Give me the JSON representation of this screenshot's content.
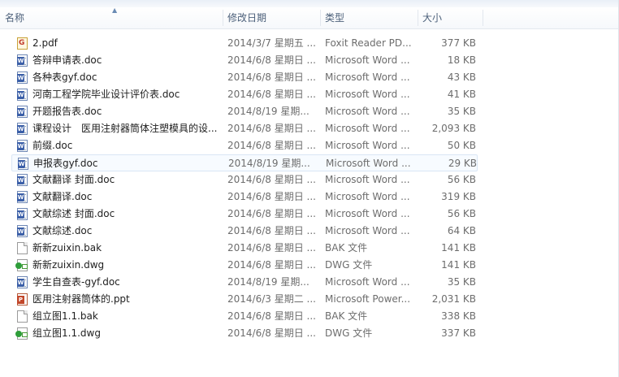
{
  "columns": {
    "name": "名称",
    "date": "修改日期",
    "type": "类型",
    "size": "大小"
  },
  "files": [
    {
      "name": "2.pdf",
      "date": "2014/3/7 星期五 ...",
      "type": "Foxit Reader PD...",
      "size": "377 KB",
      "icon": "pdf-icon"
    },
    {
      "name": "答辩申请表.doc",
      "date": "2014/6/8 星期日 ...",
      "type": "Microsoft Word ...",
      "size": "18 KB",
      "icon": "word-doc-icon"
    },
    {
      "name": "各种表gyf.doc",
      "date": "2014/6/8 星期日 ...",
      "type": "Microsoft Word ...",
      "size": "43 KB",
      "icon": "word-doc-icon"
    },
    {
      "name": "河南工程学院毕业设计评价表.doc",
      "date": "2014/6/8 星期日 ...",
      "type": "Microsoft Word ...",
      "size": "41 KB",
      "icon": "word-doc-icon"
    },
    {
      "name": "开题报告表.doc",
      "date": "2014/8/19 星期...",
      "type": "Microsoft Word ...",
      "size": "35 KB",
      "icon": "word-doc-icon"
    },
    {
      "name": "课程设计　医用注射器筒体注塑模具的设...",
      "date": "2014/6/8 星期日 ...",
      "type": "Microsoft Word ...",
      "size": "2,093 KB",
      "icon": "word-doc-icon"
    },
    {
      "name": "前缀.doc",
      "date": "2014/6/8 星期日 ...",
      "type": "Microsoft Word ...",
      "size": "50 KB",
      "icon": "word-doc-icon"
    },
    {
      "name": "申报表gyf.doc",
      "date": "2014/8/19 星期...",
      "type": "Microsoft Word ...",
      "size": "29 KB",
      "icon": "word-doc-icon",
      "selected": true
    },
    {
      "name": "文献翻译 封面.doc",
      "date": "2014/6/8 星期日 ...",
      "type": "Microsoft Word ...",
      "size": "56 KB",
      "icon": "word-doc-icon"
    },
    {
      "name": "文献翻译.doc",
      "date": "2014/6/8 星期日 ...",
      "type": "Microsoft Word ...",
      "size": "319 KB",
      "icon": "word-doc-icon"
    },
    {
      "name": "文献综述 封面.doc",
      "date": "2014/6/8 星期日 ...",
      "type": "Microsoft Word ...",
      "size": "56 KB",
      "icon": "word-doc-icon"
    },
    {
      "name": "文献综述.doc",
      "date": "2014/6/8 星期日 ...",
      "type": "Microsoft Word ...",
      "size": "64 KB",
      "icon": "word-doc-icon"
    },
    {
      "name": "新新zuixin.bak",
      "date": "2014/6/8 星期日 ...",
      "type": "BAK 文件",
      "size": "141 KB",
      "icon": "blank-file-icon"
    },
    {
      "name": "新新zuixin.dwg",
      "date": "2014/6/8 星期日 ...",
      "type": "DWG 文件",
      "size": "141 KB",
      "icon": "dwg-file-icon"
    },
    {
      "name": "学生自查表-gyf.doc",
      "date": "2014/8/19 星期...",
      "type": "Microsoft Word ...",
      "size": "35 KB",
      "icon": "word-doc-icon"
    },
    {
      "name": "医用注射器筒体的.ppt",
      "date": "2014/6/3 星期二 ...",
      "type": "Microsoft Power...",
      "size": "2,031 KB",
      "icon": "powerpoint-icon"
    },
    {
      "name": "组立图1.1.bak",
      "date": "2014/6/8 星期日 ...",
      "type": "BAK 文件",
      "size": "338 KB",
      "icon": "blank-file-icon"
    },
    {
      "name": "组立图1.1.dwg",
      "date": "2014/6/8 星期日 ...",
      "type": "DWG 文件",
      "size": "337 KB",
      "icon": "dwg-file-icon"
    }
  ]
}
